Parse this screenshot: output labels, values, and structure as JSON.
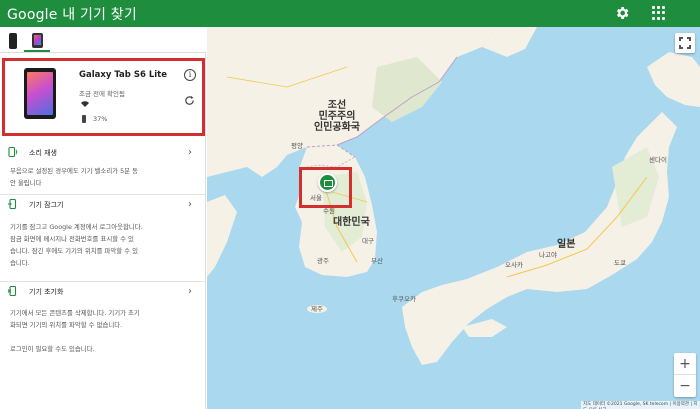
{
  "appbar": {
    "title": "Google 내 기기 찾기",
    "bg_color": "#1e8e3e",
    "settings_icon": "gear-icon",
    "apps_icon": "apps-grid-icon"
  },
  "device_tabs": [
    {
      "icon": "phone-icon"
    },
    {
      "icon": "tablet-icon",
      "selected": true
    }
  ],
  "device": {
    "name": "Galaxy Tab S6 Lite",
    "status": "조금 전에 확인됨",
    "battery": "37%",
    "info_icon": "info-icon",
    "refresh_icon": "refresh-icon"
  },
  "actions": [
    {
      "title": "소리 재생",
      "desc": [
        "무음으로 설정된 경우에도 기기 벨소리가 5분 동",
        "안 울립니다"
      ],
      "icon": "ring-phone-icon"
    },
    {
      "title": "기기 잠그기",
      "desc": [
        "기기를 잠그고 Google 계정에서 로그아웃합니다.",
        "잠금 화면에 메시지나 전화번호를 표시할 수 있",
        "습니다. 잠긴 후에도 기기의 위치를 파악할 수 있",
        "습니다."
      ],
      "icon": "lock-phone-icon"
    },
    {
      "title": "기기 초기화",
      "desc": [
        "기기에서 모든 콘텐츠를 삭제합니다. 기기가 초기",
        "화되면 기기의 위치를 파악할 수 없습니다.",
        "",
        "로그인이 필요할 수도 있습니다."
      ],
      "icon": "erase-phone-icon"
    }
  ],
  "map": {
    "labels": {
      "nk": "조선\n민주주의\n인민공화국",
      "sk": "대한민국",
      "japan": "일본",
      "pyongyang": "평양",
      "seoul": "서울",
      "suwon": "수원",
      "daegu": "대구",
      "gwangju": "광주",
      "busan": "부산",
      "jeju": "제주",
      "fukuoka": "후쿠오카",
      "osaka": "오사카",
      "nagoya": "나고야",
      "tokyo": "도쿄",
      "sendai": "센다이"
    },
    "fullscreen_icon": "fullscreen-icon",
    "zoom_in": "+",
    "zoom_out": "−",
    "attribution": "지도 데이터 ©2021 Google, SK telecom  |  이용약관  |  지도 오류 신고",
    "marker_icon": "device-location-marker-icon",
    "land_color": "#f5f1e6",
    "water_color": "#a9d8ef"
  }
}
